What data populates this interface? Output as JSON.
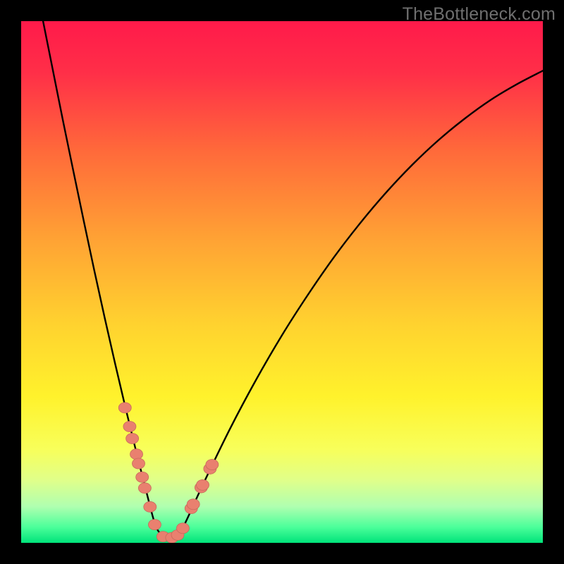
{
  "watermark": "TheBottleneck.com",
  "colors": {
    "frame": "#000000",
    "curve_stroke": "#000000",
    "marker_fill": "#e9806f",
    "marker_stroke": "#c76a5b",
    "gradient_stops": [
      {
        "offset": 0.0,
        "color": "#ff1a4a"
      },
      {
        "offset": 0.1,
        "color": "#ff2f48"
      },
      {
        "offset": 0.25,
        "color": "#ff6a3a"
      },
      {
        "offset": 0.42,
        "color": "#ffa334"
      },
      {
        "offset": 0.58,
        "color": "#ffd22f"
      },
      {
        "offset": 0.72,
        "color": "#fff22c"
      },
      {
        "offset": 0.82,
        "color": "#f8ff5a"
      },
      {
        "offset": 0.88,
        "color": "#e0ff8a"
      },
      {
        "offset": 0.93,
        "color": "#b0ffb0"
      },
      {
        "offset": 0.97,
        "color": "#4bff9a"
      },
      {
        "offset": 1.0,
        "color": "#00e37a"
      }
    ]
  },
  "chart_data": {
    "type": "line",
    "title": "",
    "xlabel": "",
    "ylabel": "",
    "xlim": [
      0,
      1
    ],
    "ylim": [
      0,
      1
    ],
    "description": "V-shaped bottleneck curve with scattered sample markers clustered near the valley. Left branch is steep; right branch rises with decreasing slope. Background is a vertical rainbow gradient (red→yellow→green). Axes are unlabeled; values are normalized 0–1.",
    "series": [
      {
        "name": "left-branch",
        "x": [
          0.04,
          0.06,
          0.08,
          0.1,
          0.12,
          0.14,
          0.16,
          0.18,
          0.2,
          0.22,
          0.24,
          0.257
        ],
        "y": [
          1.01,
          0.91,
          0.81,
          0.713,
          0.617,
          0.523,
          0.432,
          0.344,
          0.259,
          0.177,
          0.098,
          0.035
        ]
      },
      {
        "name": "valley",
        "x": [
          0.257,
          0.27,
          0.285,
          0.3,
          0.313
        ],
        "y": [
          0.035,
          0.015,
          0.008,
          0.015,
          0.035
        ]
      },
      {
        "name": "right-branch",
        "x": [
          0.313,
          0.35,
          0.4,
          0.45,
          0.5,
          0.55,
          0.6,
          0.65,
          0.7,
          0.75,
          0.8,
          0.85,
          0.9,
          0.95,
          1.0
        ],
        "y": [
          0.035,
          0.115,
          0.218,
          0.312,
          0.398,
          0.476,
          0.548,
          0.613,
          0.672,
          0.725,
          0.772,
          0.813,
          0.849,
          0.879,
          0.905
        ]
      }
    ],
    "markers": {
      "name": "sample-points",
      "x": [
        0.199,
        0.208,
        0.213,
        0.221,
        0.225,
        0.232,
        0.237,
        0.247,
        0.256,
        0.272,
        0.289,
        0.3,
        0.31,
        0.326,
        0.33,
        0.345,
        0.348,
        0.362,
        0.366
      ],
      "y": [
        0.259,
        0.223,
        0.2,
        0.17,
        0.152,
        0.126,
        0.105,
        0.069,
        0.035,
        0.012,
        0.01,
        0.015,
        0.028,
        0.066,
        0.074,
        0.106,
        0.111,
        0.142,
        0.15
      ]
    }
  }
}
